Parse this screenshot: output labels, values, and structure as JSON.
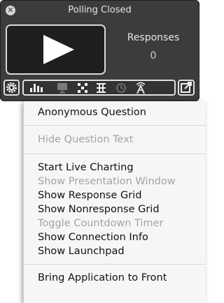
{
  "window": {
    "title": "Polling Closed",
    "close_glyph": "✕"
  },
  "responses": {
    "label": "Responses",
    "count": "0"
  },
  "toolbar": {
    "icons": [
      "gear-icon",
      "bar-chart-icon",
      "presentation-icon",
      "response-grid-icon",
      "nonresponse-grid-icon",
      "countdown-timer-icon",
      "connection-icon",
      "popout-icon"
    ]
  },
  "menu": {
    "group1": [
      "Anonymous Question"
    ],
    "group2": [
      "Hide Question Text"
    ],
    "group3": [
      "Start Live Charting",
      "Show Presentation Window",
      "Show Response Grid",
      "Show Nonresponse Grid",
      "Toggle Countdown Timer",
      "Show Connection Info",
      "Show Launchpad"
    ],
    "group4": [
      "Bring Application to Front"
    ]
  },
  "colors": {
    "panel_bg": "#3c3c3c",
    "menu_bg": "#f6f6f6",
    "enabled_text": "#111111",
    "disabled_text": "#a3a3a3"
  }
}
